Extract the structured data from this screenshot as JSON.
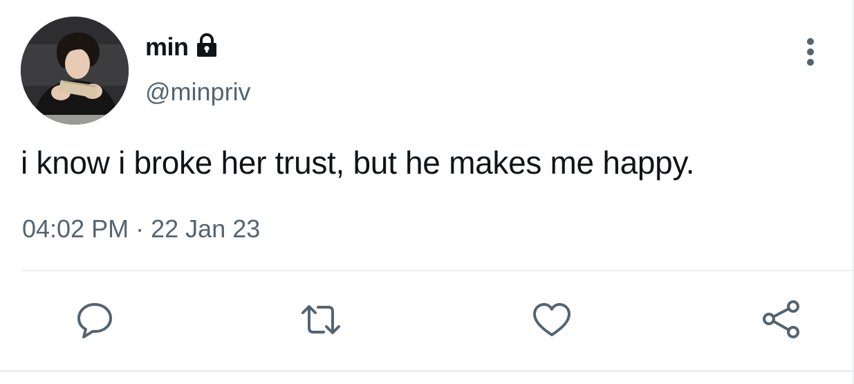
{
  "user": {
    "display_name": "min",
    "handle": "@minpriv",
    "avatar_icon": "profile-photo",
    "protected_icon": "lock-icon"
  },
  "tweet": {
    "text": "i know i broke her trust, but he makes me happy.",
    "time": "04:02 PM",
    "separator": "·",
    "date": "22 Jan 23"
  },
  "actions": {
    "reply_icon": "speech-bubble-icon",
    "retweet_icon": "retweet-icon",
    "like_icon": "heart-icon",
    "share_icon": "share-icon",
    "more_icon": "vertical-dots-icon"
  },
  "colors": {
    "text_primary": "#0f1419",
    "text_secondary": "#536471",
    "divider": "#eceff1"
  }
}
